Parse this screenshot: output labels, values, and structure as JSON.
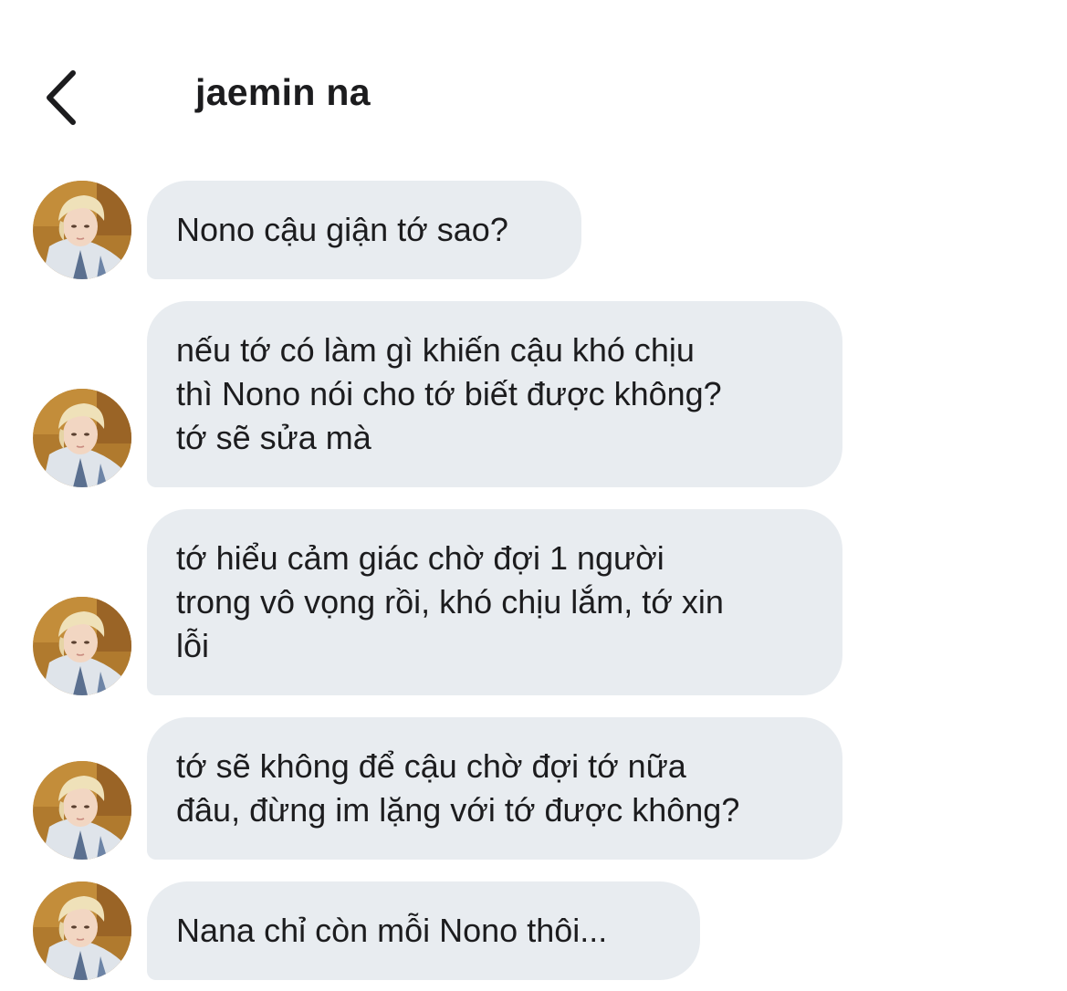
{
  "header": {
    "title": "jaemin na",
    "back_icon": "chevron-left-icon"
  },
  "colors": {
    "bubble_background": "#e8ecf0",
    "text": "#1c1c1e",
    "background": "#ffffff"
  },
  "messages": [
    {
      "sender": "jaemin na",
      "avatar_icon": "profile-photo",
      "text": "Nono cậu giận tớ sao?"
    },
    {
      "sender": "jaemin na",
      "avatar_icon": "profile-photo",
      "text": "nếu tớ có làm gì khiến cậu khó chịu\nthì Nono nói cho tớ biết được không?\ntớ sẽ sửa mà"
    },
    {
      "sender": "jaemin na",
      "avatar_icon": "profile-photo",
      "text": "tớ hiểu cảm giác chờ đợi 1 người\ntrong vô vọng rồi, khó chịu lắm, tớ xin\nlỗi"
    },
    {
      "sender": "jaemin na",
      "avatar_icon": "profile-photo",
      "text": "tớ sẽ không để cậu chờ đợi tớ nữa\nđâu, đừng im lặng với tớ được không?"
    },
    {
      "sender": "jaemin na",
      "avatar_icon": "profile-photo",
      "text": "Nana chỉ còn mỗi Nono thôi..."
    }
  ]
}
